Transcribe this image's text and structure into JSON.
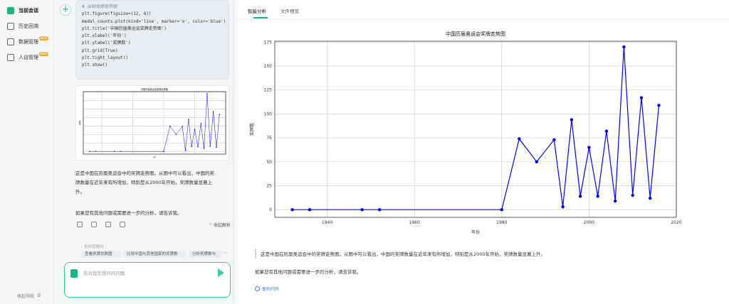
{
  "nav": {
    "items": [
      {
        "label": "当前会话",
        "active": true,
        "badge": ""
      },
      {
        "label": "历史回溯",
        "active": false,
        "badge": ""
      },
      {
        "label": "数据管理",
        "active": false,
        "badge": "NEW"
      },
      {
        "label": "人设管理",
        "active": false,
        "badge": "NEW"
      }
    ],
    "collapse_label": "收起导航"
  },
  "conversation": {
    "code_lines": [
      {
        "text": "# 绘制奖牌走势图",
        "cls": "cm"
      },
      {
        "text": "plt.figure(figsize=(12, 6))",
        "cls": ""
      },
      {
        "text": "medal_counts.plot(kind='line', marker='o', color='blue')",
        "cls": ""
      },
      {
        "text": "plt.title('中国历届奥运会奖牌走势图')",
        "cls": ""
      },
      {
        "text": "plt.xlabel('年份')",
        "cls": ""
      },
      {
        "text": "plt.ylabel('奖牌数')",
        "cls": ""
      },
      {
        "text": "plt.grid(True)",
        "cls": ""
      },
      {
        "text": "plt.tight_layout()",
        "cls": ""
      },
      {
        "text": "plt.show()",
        "cls": ""
      }
    ],
    "thumb_title": "中国历届奥运会奖牌走势图",
    "thumb_xlabel": "年份",
    "thumb_ylabel": "奖牌数",
    "message_lines": [
      "这是中国在历届奥运会中的奖牌走势图。从图中可以看出，中国的奖",
      "牌数量在近年来有所增加，特别是从2000年开始，奖牌数量显著上",
      "升。"
    ],
    "message_followup": "如果您有其他问题或需要进一步的分析，请告诉我。",
    "collapse_analysis": "收起解析",
    "suggestion_label": "- 也许您想问 -",
    "suggestions": [
      "查看奖牌总数图",
      "比较中国与其他国家的奖牌数",
      "分析奖牌数与"
    ],
    "more": "···",
    "input_placeholder": "告诉我您想问的问题"
  },
  "tabs": [
    {
      "label": "智能分析",
      "active": true
    },
    {
      "label": "文件预览",
      "active": false
    }
  ],
  "chart_data": {
    "type": "line",
    "title": "中国历届奥运会奖牌走势图",
    "xlabel": "年份",
    "ylabel": "奖牌数",
    "color": "#0000ff",
    "grid": true,
    "xlim": [
      1928,
      2020
    ],
    "ylim": [
      -8,
      176
    ],
    "xticks": [
      1940,
      1960,
      1980,
      2000,
      2020
    ],
    "yticks": [
      0,
      25,
      50,
      75,
      100,
      125,
      150,
      175
    ],
    "x": [
      1932,
      1936,
      1948,
      1952,
      1980,
      1984,
      1988,
      1992,
      1994,
      1996,
      1998,
      2000,
      2002,
      2004,
      2006,
      2008,
      2010,
      2012,
      2014,
      2016
    ],
    "y": [
      0,
      0,
      0,
      0,
      0,
      74,
      50,
      73,
      3,
      94,
      14,
      65,
      14,
      82,
      9,
      170,
      15,
      117,
      12,
      109
    ]
  },
  "analysis": {
    "text1": "这是中国在历届奥运会中的奖牌走势图。从图中可以看出，中国的奖牌数量在近年来有所增加，特别是从2000年开始，奖牌数量显著上升。",
    "text2": "如果您有其他问题或需要进一步的分析，请告诉我。",
    "copy_code": "复制代码"
  },
  "colors": {
    "accent": "#12b886",
    "line": "#0000ff"
  }
}
